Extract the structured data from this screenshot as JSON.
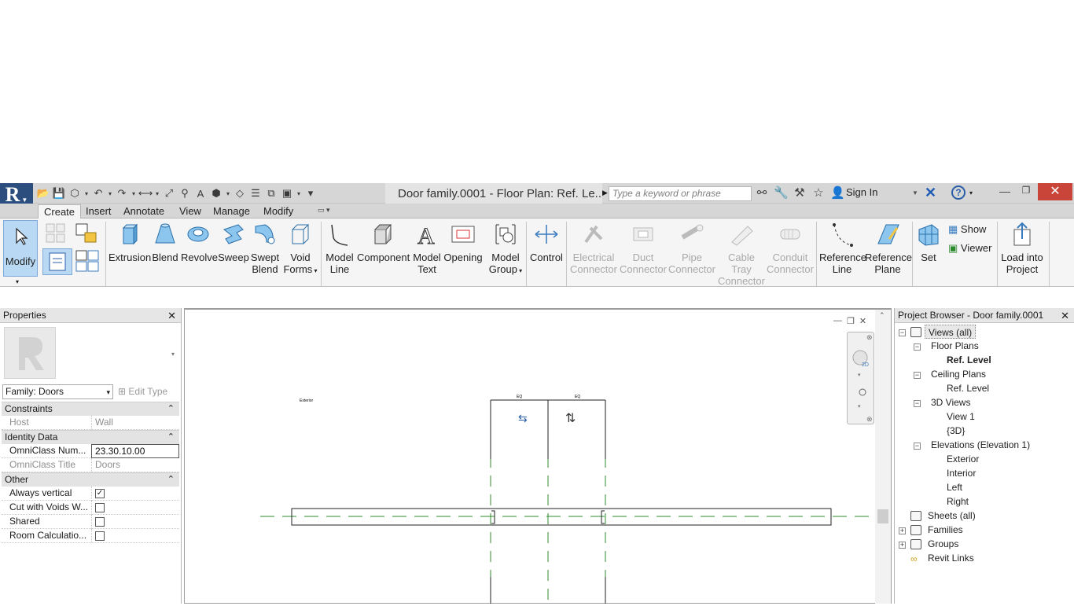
{
  "window": {
    "document_title": "Door family.0001 - Floor Plan: Ref. Le...",
    "search_placeholder": "Type a keyword or phrase",
    "sign_in": "Sign In"
  },
  "tabs": [
    "Create",
    "Insert",
    "Annotate",
    "View",
    "Manage",
    "Modify"
  ],
  "ribbon": {
    "modify": "Modify",
    "form": [
      {
        "line1": "Extrusion",
        "line2": ""
      },
      {
        "line1": "Blend",
        "line2": ""
      },
      {
        "line1": "Revolve",
        "line2": ""
      },
      {
        "line1": "Sweep",
        "line2": ""
      },
      {
        "line1": "Swept",
        "line2": "Blend"
      },
      {
        "line1": "Void",
        "line2": "Forms"
      }
    ],
    "model": [
      {
        "line1": "Model",
        "line2": "Line"
      },
      {
        "line1": "Component",
        "line2": ""
      },
      {
        "line1": "Model",
        "line2": "Text"
      },
      {
        "line1": "Opening",
        "line2": ""
      },
      {
        "line1": "Model",
        "line2": "Group"
      }
    ],
    "control": "Control",
    "connectors": [
      {
        "line1": "Electrical",
        "line2": "Connector"
      },
      {
        "line1": "Duct",
        "line2": "Connector"
      },
      {
        "line1": "Pipe",
        "line2": "Connector"
      },
      {
        "line1": "Cable Tray",
        "line2": "Connector"
      },
      {
        "line1": "Conduit",
        "line2": "Connector"
      }
    ],
    "datum": [
      {
        "line1": "Reference",
        "line2": "Line"
      },
      {
        "line1": "Reference",
        "line2": "Plane"
      }
    ],
    "set": "Set",
    "show": "Show",
    "viewer": "Viewer",
    "load_into": {
      "line1": "Load into",
      "line2": "Project"
    }
  },
  "properties": {
    "title": "Properties",
    "family": "Family: Doors",
    "edit_type": "Edit Type",
    "sections": {
      "constraints": "Constraints",
      "identity": "Identity Data",
      "other": "Other"
    },
    "rows": {
      "host": {
        "key": "Host",
        "value": "Wall"
      },
      "omni_num": {
        "key": "OmniClass Num...",
        "value": "23.30.10.00"
      },
      "omni_title": {
        "key": "OmniClass Title",
        "value": "Doors"
      },
      "always_vertical": {
        "key": "Always vertical",
        "checked": true
      },
      "cut_voids": {
        "key": "Cut with Voids W...",
        "checked": false
      },
      "shared": {
        "key": "Shared",
        "checked": false
      },
      "room_calc": {
        "key": "Room Calculatio...",
        "checked": false
      }
    }
  },
  "canvas": {
    "label_exterior": "Exterior",
    "dim_a": "EQ",
    "dim_b": "EQ"
  },
  "browser": {
    "title": "Project Browser - Door family.0001",
    "views_all": "Views (all)",
    "floor_plans": "Floor Plans",
    "fp_ref_level": "Ref. Level",
    "ceiling_plans": "Ceiling Plans",
    "cp_ref_level": "Ref. Level",
    "views_3d": "3D Views",
    "view1": "View 1",
    "view_3d": "{3D}",
    "elevations": "Elevations (Elevation 1)",
    "exterior": "Exterior",
    "interior": "Interior",
    "left": "Left",
    "right": "Right",
    "sheets": "Sheets (all)",
    "families": "Families",
    "groups": "Groups",
    "revit_links": "Revit Links"
  },
  "colors": {
    "titlebar": "#d6d6d6",
    "app_button": "#2b4e7e",
    "close_button": "#c9453a",
    "selected_tool": "#b9d8f3",
    "ref_plane_green": "#2e8b2e",
    "icon_blue": "#3a7bbf"
  }
}
